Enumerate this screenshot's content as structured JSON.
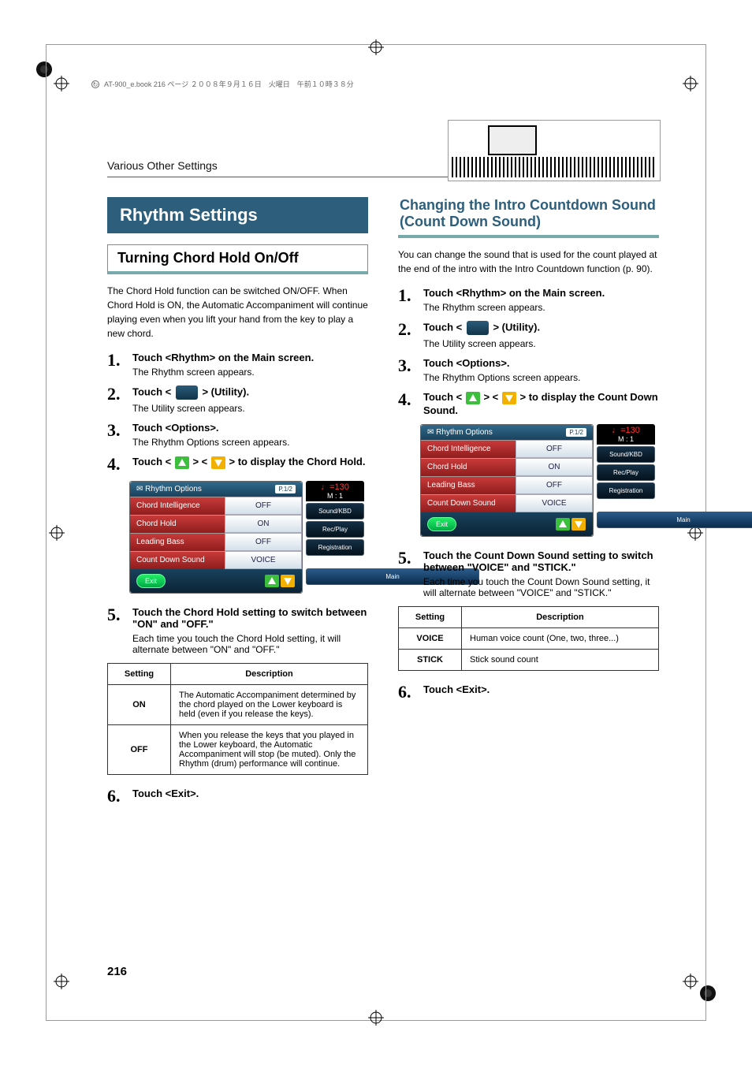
{
  "meta": {
    "book_line": "AT-900_e.book 216 ページ ２００８年９月１６日　火曜日　午前１０時３８分",
    "section_title": "Various Other Settings",
    "page_number": "216"
  },
  "left": {
    "h1": "Rhythm Settings",
    "h2": "Turning Chord Hold On/Off",
    "intro": "The Chord Hold function can be switched ON/OFF. When Chord Hold is ON, the Automatic Accompaniment will continue playing even when you lift your hand from the key to play a new chord.",
    "steps": [
      {
        "num": "1.",
        "strong": "Touch <Rhythm> on the Main screen.",
        "desc": "The Rhythm screen appears."
      },
      {
        "num": "2.",
        "strong_pre": "Touch < ",
        "strong_post": " > (Utility).",
        "desc": "The Utility screen appears.",
        "has_icon": true
      },
      {
        "num": "3.",
        "strong": "Touch <Options>.",
        "desc": "The Rhythm Options screen appears."
      },
      {
        "num": "4.",
        "strong_pre": "Touch < ",
        "strong_mid": " > < ",
        "strong_post": " > to display the Chord Hold.",
        "has_arrows": true
      }
    ],
    "screenshot": {
      "title": "Rhythm Options",
      "page": "P.1/2",
      "rows": [
        {
          "l": "Chord Intelligence",
          "r": "OFF"
        },
        {
          "l": "Chord Hold",
          "r": "ON"
        },
        {
          "l": "Leading Bass",
          "r": "OFF"
        },
        {
          "l": "Count Down Sound",
          "r": "VOICE"
        }
      ],
      "exit": "Exit",
      "tempo": "♩=130",
      "tempo_m": "M :    1",
      "side": [
        "Sound/KBD",
        "Rec/Play",
        "Registration"
      ],
      "main": "Main"
    },
    "step5": {
      "num": "5.",
      "strong": "Touch the Chord Hold setting to switch between \"ON\" and \"OFF.\"",
      "desc": "Each time you touch the Chord Hold setting, it will alternate between \"ON\" and \"OFF.\""
    },
    "table": {
      "headers": [
        "Setting",
        "Description"
      ],
      "rows": [
        {
          "k": "ON",
          "v": "The Automatic Accompaniment determined by the chord played on the Lower keyboard is held (even if you release the keys)."
        },
        {
          "k": "OFF",
          "v": "When you release the keys that you played in the Lower keyboard, the Automatic Accompaniment will stop (be muted). Only the Rhythm (drum) performance will continue."
        }
      ]
    },
    "step6": {
      "num": "6.",
      "strong": "Touch <Exit>."
    }
  },
  "right": {
    "h2": "Changing the Intro Countdown Sound (Count Down Sound)",
    "intro": "You can change the sound that is used for the count played at the end of the intro with the Intro Countdown function (p. 90).",
    "steps": [
      {
        "num": "1.",
        "strong": "Touch <Rhythm> on the Main screen.",
        "desc": "The Rhythm screen appears."
      },
      {
        "num": "2.",
        "strong_pre": "Touch < ",
        "strong_post": " > (Utility).",
        "desc": "The Utility screen appears.",
        "has_icon": true
      },
      {
        "num": "3.",
        "strong": "Touch <Options>.",
        "desc": "The Rhythm Options screen appears."
      },
      {
        "num": "4.",
        "strong_pre": "Touch < ",
        "strong_mid": " > < ",
        "strong_post": " > to display the Count Down Sound.",
        "has_arrows": true
      }
    ],
    "screenshot": {
      "title": "Rhythm Options",
      "page": "P.1/2",
      "rows": [
        {
          "l": "Chord Intelligence",
          "r": "OFF"
        },
        {
          "l": "Chord Hold",
          "r": "ON"
        },
        {
          "l": "Leading Bass",
          "r": "OFF"
        },
        {
          "l": "Count Down Sound",
          "r": "VOICE"
        }
      ],
      "exit": "Exit",
      "tempo": "♩=130",
      "tempo_m": "M :    1",
      "side": [
        "Sound/KBD",
        "Rec/Play",
        "Registration"
      ],
      "main": "Main"
    },
    "step5": {
      "num": "5.",
      "strong": "Touch the Count Down Sound setting to switch between \"VOICE\" and \"STICK.\"",
      "desc": "Each time you touch the Count Down Sound setting, it will alternate between \"VOICE\" and \"STICK.\""
    },
    "table": {
      "headers": [
        "Setting",
        "Description"
      ],
      "rows": [
        {
          "k": "VOICE",
          "v": "Human voice count (One, two, three...)"
        },
        {
          "k": "STICK",
          "v": "Stick sound count"
        }
      ]
    },
    "step6": {
      "num": "6.",
      "strong": "Touch <Exit>."
    }
  }
}
